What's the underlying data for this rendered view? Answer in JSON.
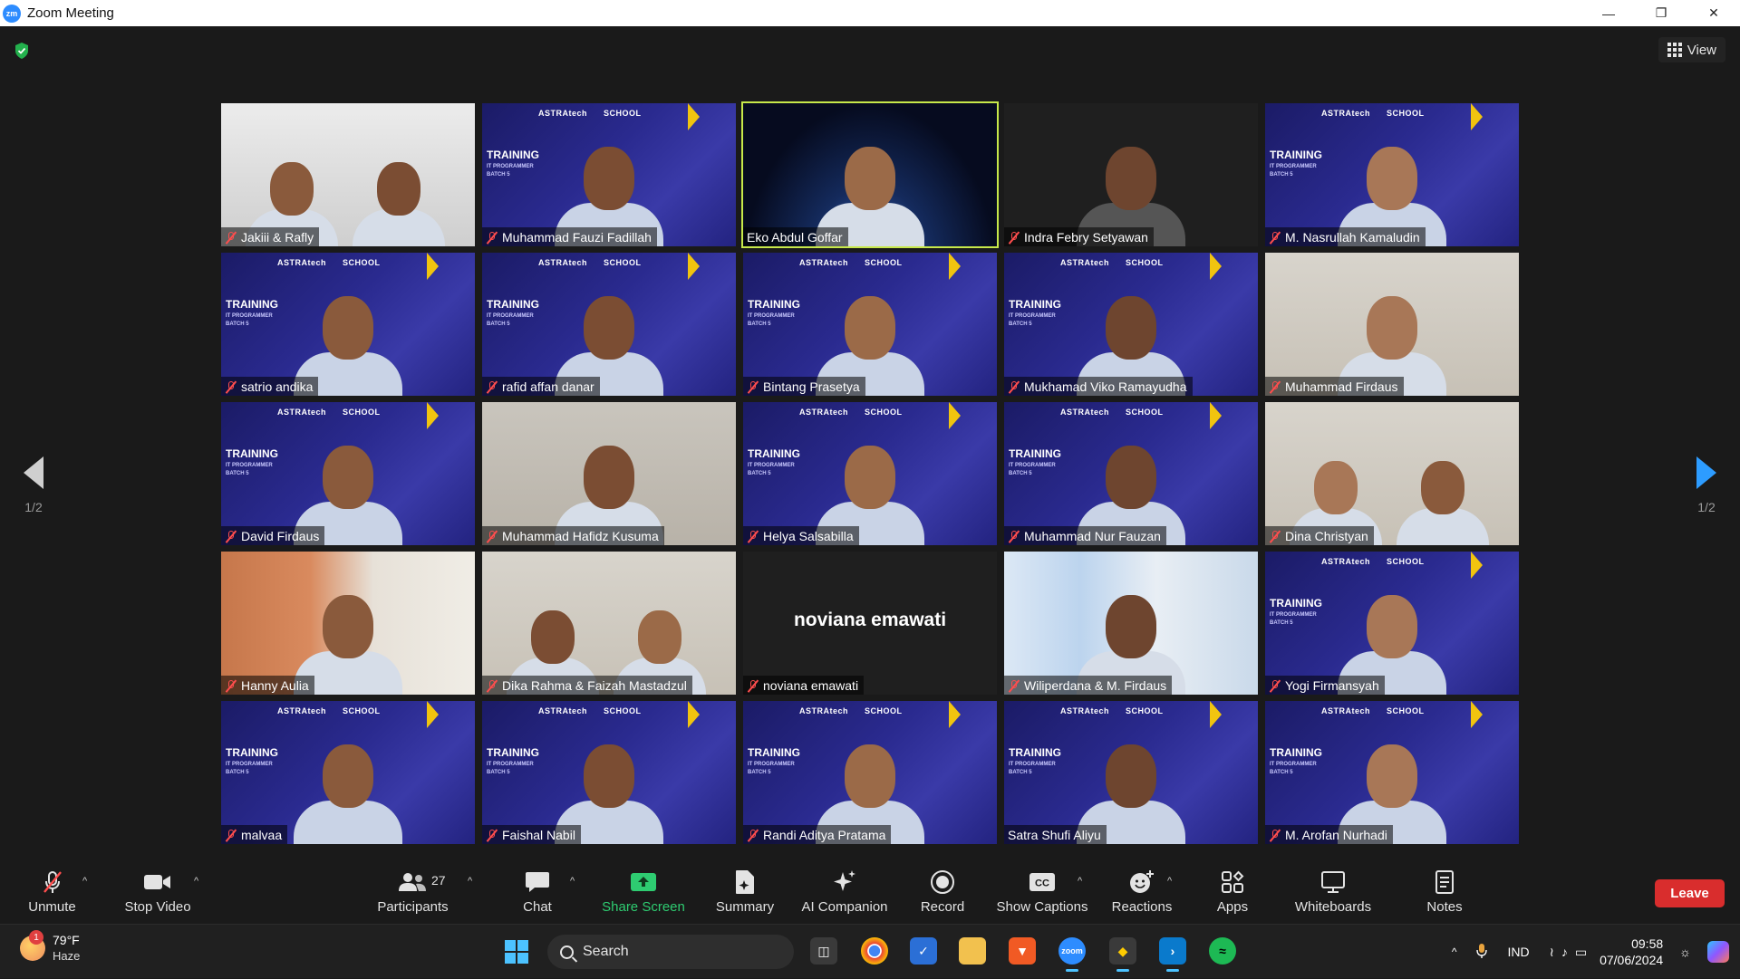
{
  "window": {
    "title": "Zoom Meeting"
  },
  "view_button": {
    "label": "View"
  },
  "pager": {
    "left": "1/2",
    "right": "1/2"
  },
  "tiles": [
    {
      "name": "Jakiii & Rafly",
      "muted": true,
      "bg": "room",
      "people": 2,
      "active": false
    },
    {
      "name": "Muhammad Fauzi Fadillah",
      "muted": true,
      "bg": "training",
      "people": 1,
      "active": false
    },
    {
      "name": "Eko Abdul Goffar",
      "muted": false,
      "bg": "space",
      "people": 1,
      "active": true
    },
    {
      "name": "Indra Febry Setyawan",
      "muted": true,
      "bg": "dark",
      "people": 1,
      "active": false
    },
    {
      "name": "M. Nasrullah Kamaludin",
      "muted": true,
      "bg": "training",
      "people": 1,
      "active": false
    },
    {
      "name": "satrio andika",
      "muted": true,
      "bg": "training",
      "people": 1,
      "active": false
    },
    {
      "name": "rafid affan danar",
      "muted": true,
      "bg": "training",
      "people": 1,
      "active": false
    },
    {
      "name": "Bintang Prasetya",
      "muted": true,
      "bg": "training",
      "people": 1,
      "active": false
    },
    {
      "name": "Mukhamad Viko Ramayudha",
      "muted": true,
      "bg": "training",
      "people": 1,
      "active": false
    },
    {
      "name": "Muhammad Firdaus",
      "muted": true,
      "bg": "wall",
      "people": 1,
      "active": false
    },
    {
      "name": "David Firdaus",
      "muted": true,
      "bg": "training",
      "people": 1,
      "active": false
    },
    {
      "name": "Muhammad Hafidz Kusuma",
      "muted": true,
      "bg": "wall2",
      "people": 1,
      "active": false
    },
    {
      "name": "Helya Salsabilla",
      "muted": true,
      "bg": "training",
      "people": 1,
      "active": false
    },
    {
      "name": "Muhammad Nur Fauzan",
      "muted": true,
      "bg": "training",
      "people": 1,
      "active": false
    },
    {
      "name": "Dina Christyan",
      "muted": true,
      "bg": "wall",
      "people": 2,
      "active": false
    },
    {
      "name": "Hanny Aulia",
      "muted": true,
      "bg": "orange",
      "people": 1,
      "active": false
    },
    {
      "name": "Dika Rahma & Faizah Mastadzul",
      "muted": true,
      "bg": "wall",
      "people": 2,
      "active": false
    },
    {
      "name": "noviana emawati",
      "muted": true,
      "bg": "dark",
      "people": 0,
      "active": false,
      "video_off_name": "noviana emawati"
    },
    {
      "name": "Wiliperdana & M. Firdaus",
      "muted": true,
      "bg": "window",
      "people": 1,
      "active": false
    },
    {
      "name": "Yogi Firmansyah",
      "muted": true,
      "bg": "training",
      "people": 1,
      "active": false
    },
    {
      "name": "malvaa",
      "muted": true,
      "bg": "training",
      "people": 1,
      "active": false
    },
    {
      "name": "Faishal Nabil",
      "muted": true,
      "bg": "training",
      "people": 1,
      "active": false
    },
    {
      "name": "Randi Aditya Pratama",
      "muted": true,
      "bg": "training",
      "people": 1,
      "active": false
    },
    {
      "name": "Satra Shufi Aliyu",
      "muted": false,
      "bg": "training",
      "people": 1,
      "active": false
    },
    {
      "name": "M. Arofan Nurhadi",
      "muted": true,
      "bg": "training",
      "people": 1,
      "active": false
    }
  ],
  "background_text": {
    "brand": "ASTRAtech",
    "school": "SCHOOL",
    "training": "TRAINING",
    "sub1": "IT PROGRAMMER",
    "sub2": "BATCH 5"
  },
  "toolbar": {
    "unmute": "Unmute",
    "stop_video": "Stop Video",
    "participants": "Participants",
    "participants_count": "27",
    "chat": "Chat",
    "share_screen": "Share Screen",
    "summary": "Summary",
    "ai_companion": "AI Companion",
    "record": "Record",
    "show_captions": "Show Captions",
    "reactions": "Reactions",
    "apps": "Apps",
    "whiteboards": "Whiteboards",
    "notes": "Notes",
    "leave": "Leave"
  },
  "taskbar": {
    "temperature": "79°F",
    "weather": "Haze",
    "weather_badge": "1",
    "search_placeholder": "Search",
    "language": "IND",
    "time": "09:58",
    "date": "07/06/2024"
  },
  "colors": {
    "accent_blue": "#2d8cff",
    "active_speaker": "#c7e84a",
    "leave_red": "#d92d2d",
    "share_green": "#2ecc71",
    "muted_red": "#ff4d4d"
  }
}
